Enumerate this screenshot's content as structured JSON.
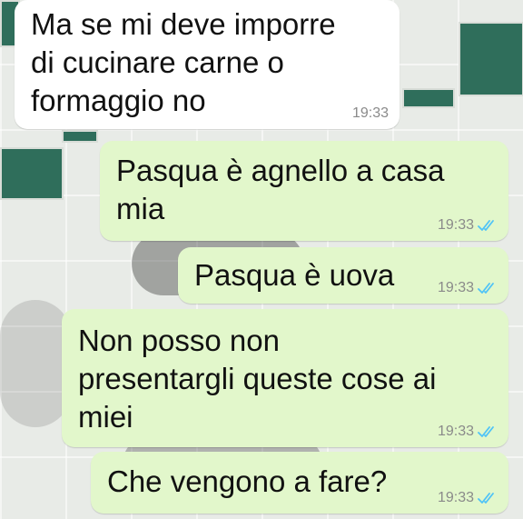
{
  "messages": [
    {
      "direction": "incoming",
      "text": "Ma se mi deve imporre\ndi cucinare carne o\nformaggio no",
      "time": "19:33"
    },
    {
      "direction": "outgoing",
      "text": "Pasqua è agnello a casa\nmia",
      "time": "19:33",
      "status_icon": "double-check-icon"
    },
    {
      "direction": "outgoing",
      "text": "Pasqua è uova",
      "time": "19:33",
      "status_icon": "double-check-icon"
    },
    {
      "direction": "outgoing",
      "text": "Non posso non\npresentargli queste cose ai\nmiei",
      "time": "19:33",
      "status_icon": "double-check-icon"
    },
    {
      "direction": "outgoing",
      "text": "Che vengono a fare?",
      "time": "19:33",
      "status_icon": "double-check-icon"
    }
  ],
  "colors": {
    "incoming_bubble": "#ffffff",
    "outgoing_bubble": "#e2f7cb",
    "tick_color": "#4fc3f7",
    "timestamp": "#8a8a8a"
  }
}
